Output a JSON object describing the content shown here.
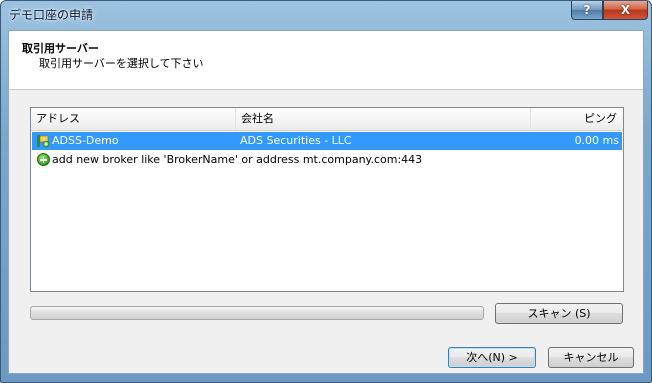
{
  "window": {
    "title": "デモ口座の申請"
  },
  "titlebar": {
    "help_label": "?",
    "close_label": "X"
  },
  "header": {
    "title": "取引用サーバー",
    "subtitle": "取引用サーバーを選択して下さい"
  },
  "list": {
    "columns": [
      "アドレス",
      "会社名",
      "ピング"
    ],
    "rows": [
      {
        "address": "ADSS-Demo",
        "company": "ADS Securities - LLC",
        "ping": "0.00 ms",
        "selected": true,
        "icon": "server-icon"
      }
    ],
    "add_row_text": "add new broker like 'BrokerName' or address mt.company.com:443",
    "add_icon": "add-icon"
  },
  "progress": {
    "value": 0
  },
  "buttons": {
    "scan": "スキャン (S)",
    "next": "次へ(N) >",
    "cancel": "キャンセル"
  }
}
